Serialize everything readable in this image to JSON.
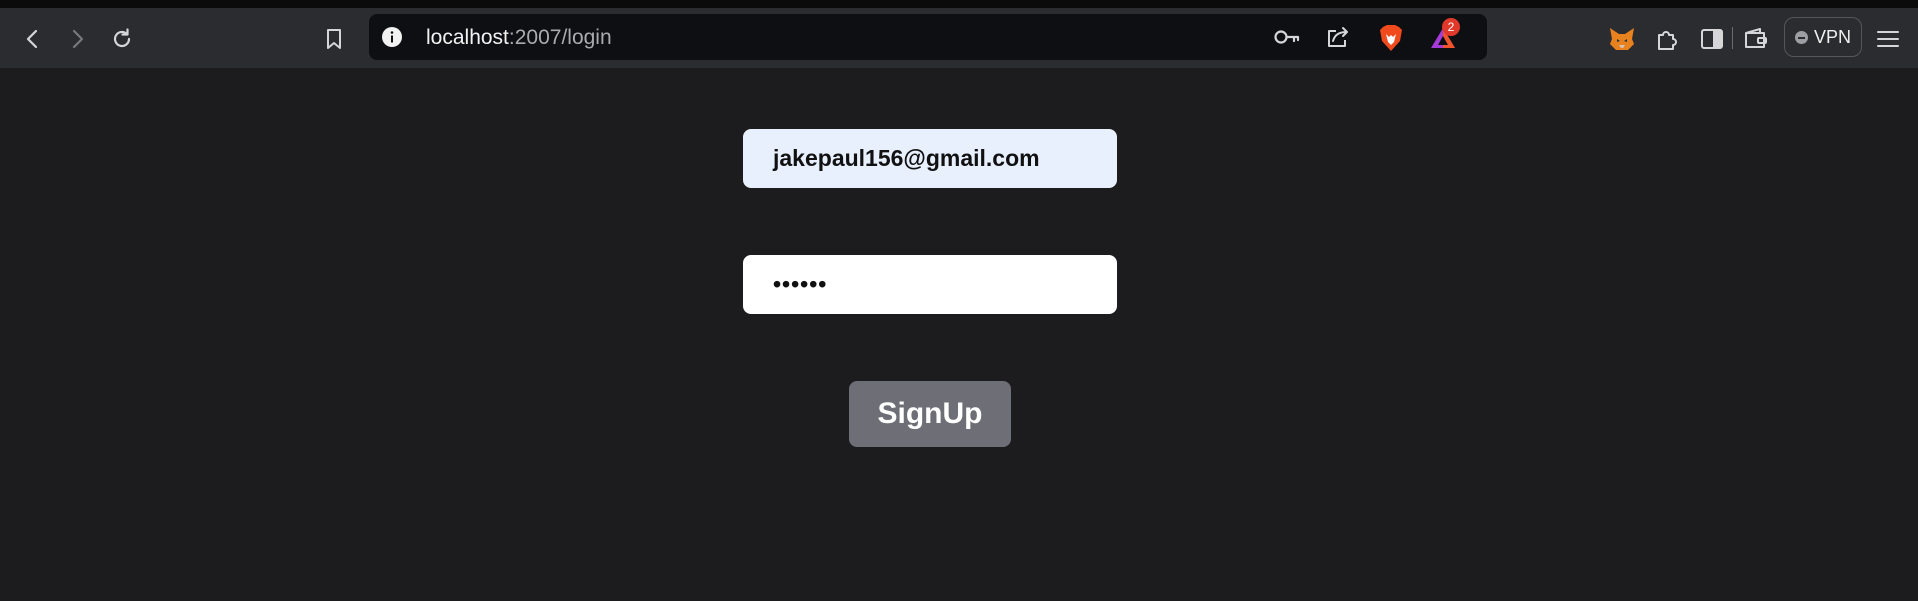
{
  "browser": {
    "url_host": "localhost",
    "url_path": ":2007/login",
    "notification_count": "2",
    "vpn_label": "VPN",
    "icons": [
      "back-icon",
      "forward-icon",
      "reload-icon",
      "bookmark-icon",
      "info-icon",
      "key-icon",
      "share-icon",
      "brave-shields-icon",
      "brave-rewards-icon",
      "metamask-fox-icon",
      "extensions-icon",
      "sidebar-icon",
      "wallet-icon",
      "menu-icon"
    ]
  },
  "form": {
    "email_value": "jakepaul156@gmail.com",
    "password_value": "••••••",
    "submit_label": "SignUp"
  },
  "colors": {
    "page_bg": "#1c1c1e",
    "toolbar_bg": "#2b2c30",
    "email_bg": "#e8f0fe",
    "button_bg": "#6e6e76"
  }
}
